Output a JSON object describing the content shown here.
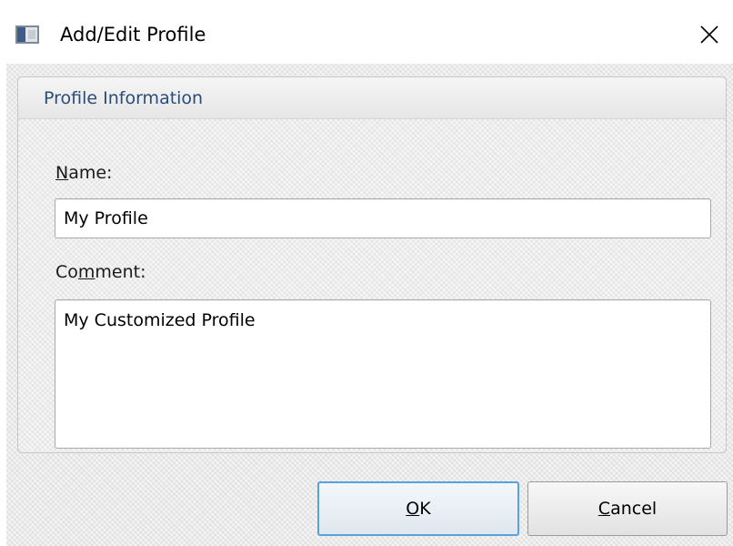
{
  "window": {
    "title": "Add/Edit Profile"
  },
  "icons": {
    "app": "app-window-icon",
    "close": "close-icon"
  },
  "group": {
    "title": "Profile Information"
  },
  "name_field": {
    "label_mnemonic": "N",
    "label_rest": "ame:",
    "value": "My Profile"
  },
  "comment_field": {
    "label_before": "Co",
    "label_mnemonic": "m",
    "label_after": "ment:",
    "value": "My Customized Profile"
  },
  "buttons": {
    "ok_mnemonic": "O",
    "ok_rest": "K",
    "cancel_mnemonic": "C",
    "cancel_rest": "ancel"
  },
  "colors": {
    "group_title": "#294d7a",
    "default_button_border": "#5aa0dc"
  }
}
